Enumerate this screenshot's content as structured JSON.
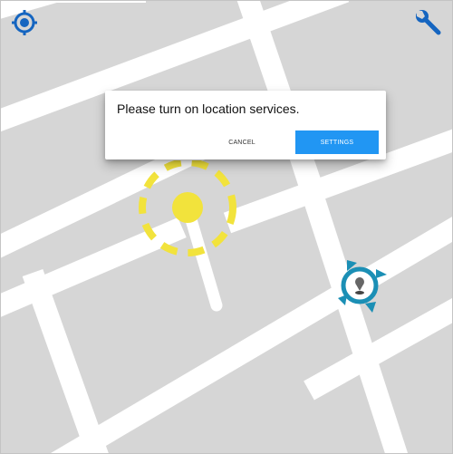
{
  "map": {
    "background_color": "#d6d6d6",
    "road_color": "#ffffff"
  },
  "toolbar": {
    "locate_icon": "crosshair-location-icon",
    "settings_icon": "wrench-icon",
    "icon_color": "#1565c0"
  },
  "dialog": {
    "message": "Please turn on location services.",
    "cancel_label": "CANCEL",
    "settings_label": "SETTINGS",
    "accent_color": "#2196f3"
  },
  "markers": {
    "user_location_icon": "user-location-marker-icon",
    "user_location_color": "#f2e33c",
    "destination_icon": "destination-pin-icon",
    "destination_color": "#1b8fb5"
  }
}
